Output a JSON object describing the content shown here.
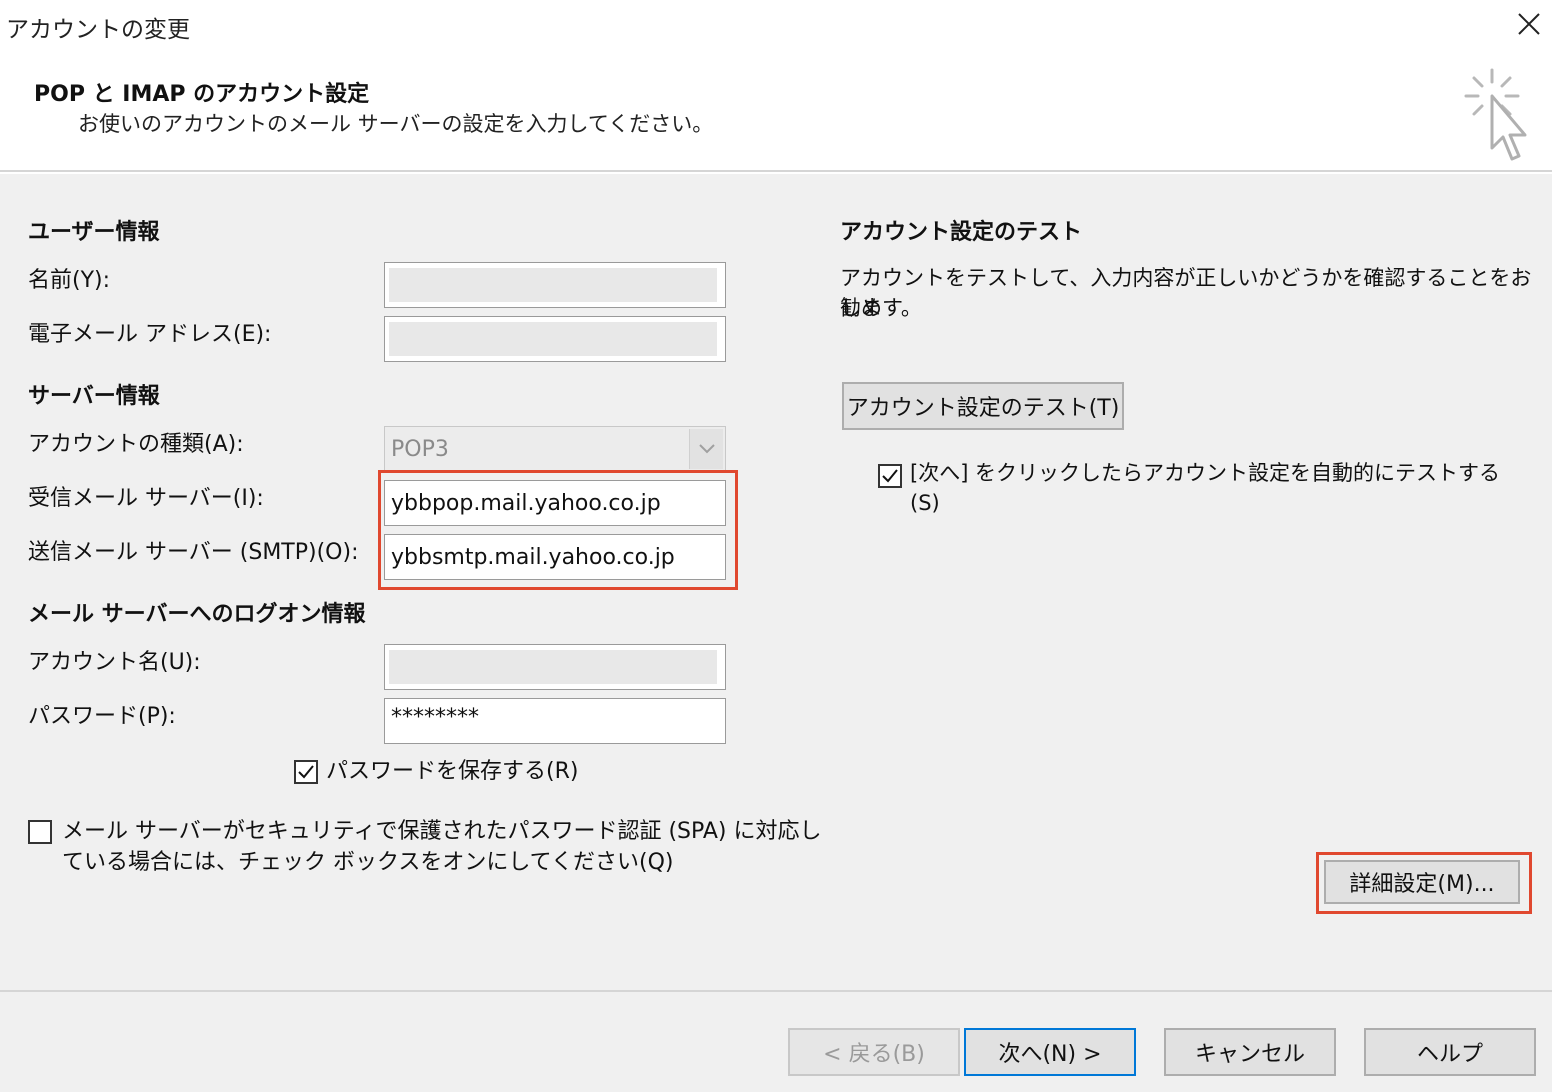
{
  "window": {
    "title": "アカウントの変更"
  },
  "header": {
    "title": "POP と IMAP のアカウント設定",
    "subtitle": "お使いのアカウントのメール サーバーの設定を入力してください。",
    "icon": "cursor-sparkle-icon"
  },
  "user_info": {
    "heading": "ユーザー情報",
    "name_label": "名前(Y):",
    "name_value": "",
    "email_label": "電子メール アドレス(E):",
    "email_value": ""
  },
  "server_info": {
    "heading": "サーバー情報",
    "account_type_label": "アカウントの種類(A):",
    "account_type_value": "POP3",
    "incoming_label": "受信メール サーバー(I):",
    "incoming_value": "ybbpop.mail.yahoo.co.jp",
    "outgoing_label": "送信メール サーバー (SMTP)(O):",
    "outgoing_value": "ybbsmtp.mail.yahoo.co.jp"
  },
  "logon_info": {
    "heading": "メール サーバーへのログオン情報",
    "account_name_label": "アカウント名(U):",
    "account_name_value": "",
    "password_label": "パスワード(P):",
    "password_value": "********",
    "save_password_label": "パスワードを保存する(R)",
    "save_password_checked": true,
    "spa_label_line1": "メール サーバーがセキュリティで保護されたパスワード認証 (SPA) に対応し",
    "spa_label_line2": "ている場合には、チェック ボックスをオンにしてください(Q)",
    "spa_checked": false
  },
  "test": {
    "heading": "アカウント設定のテスト",
    "description_line1": "アカウントをテストして、入力内容が正しいかどうかを確認することをお勧め",
    "description_line2": "します。",
    "test_button": "アカウント設定のテスト(T)",
    "auto_test_label_line1": "[次へ] をクリックしたらアカウント設定を自動的にテストする",
    "auto_test_label_line2": "(S)",
    "auto_test_checked": true
  },
  "advanced_button": "詳細設定(M)...",
  "footer": {
    "back": "< 戻る(B)",
    "next": "次へ(N) >",
    "cancel": "キャンセル",
    "help": "ヘルプ"
  },
  "colors": {
    "highlight": "#e0482f",
    "default_button_border": "#0078d7",
    "background": "#f0f0f0"
  }
}
